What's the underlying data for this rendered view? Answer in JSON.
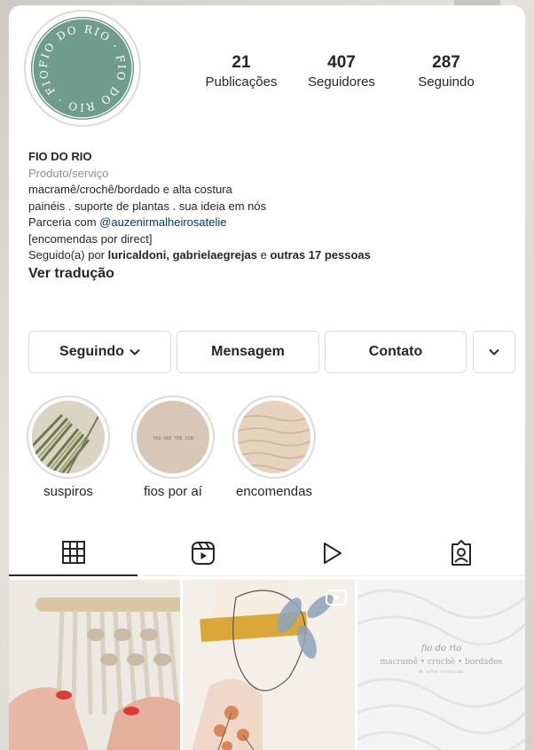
{
  "profile": {
    "avatar_text": "FIO DO RIO"
  },
  "stats": [
    {
      "value": "21",
      "label": "Publicações"
    },
    {
      "value": "407",
      "label": "Seguidores"
    },
    {
      "value": "287",
      "label": "Seguindo"
    }
  ],
  "bio": {
    "name": "FIO DO RIO",
    "category": "Produto/serviço",
    "line1": "macramê/crochê/bordado e alta costura",
    "line2": "painéis . suporte de plantas . sua ideia em nós",
    "partner_prefix": "Parceria com ",
    "partner_handle": "@auzenirmalheirosatelie",
    "line4": "[encomendas por direct]",
    "followed_prefix": "Seguido(a) por ",
    "followed_names": "luricaldoni, gabrielaegrejas",
    "followed_mid": " e ",
    "followed_rest": "outras 17 pessoas",
    "translate": "Ver tradução"
  },
  "buttons": {
    "following": "Seguindo",
    "message": "Mensagem",
    "contact": "Contato"
  },
  "highlights": [
    {
      "label": "suspiros"
    },
    {
      "label": "fios por aí",
      "image_text": "YOU ARE THE SUN"
    },
    {
      "label": "encomendas"
    }
  ],
  "tabs": [
    {
      "icon": "grid-icon"
    },
    {
      "icon": "reels-icon"
    },
    {
      "icon": "play-icon"
    },
    {
      "icon": "tagged-icon"
    }
  ],
  "posts": {
    "watermark_title": "fio do rio",
    "watermark_sub": "macramê • crochê • bordados",
    "watermark_small": "& alta costura"
  },
  "colors": {
    "avatar_bg": "#6f9c8c",
    "link": "#00376b",
    "text": "#262626",
    "muted": "#8e8e8e"
  }
}
